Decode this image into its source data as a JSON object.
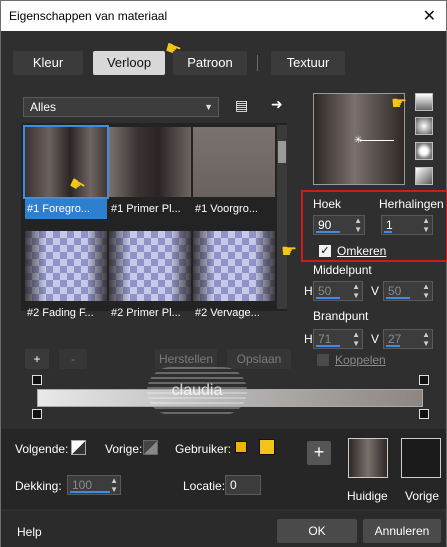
{
  "window": {
    "title": "Eigenschappen van materiaal",
    "close_icon": "close-icon"
  },
  "tabs": [
    {
      "label": "Kleur",
      "active": false
    },
    {
      "label": "Verloop",
      "active": true
    },
    {
      "label": "Patroon",
      "active": false
    },
    {
      "label": "Textuur",
      "active": false
    }
  ],
  "category": {
    "value": "Alles"
  },
  "swatches": [
    {
      "label": "#1 Foregro...",
      "selected": true
    },
    {
      "label": "#1 Primer Pl...",
      "selected": false
    },
    {
      "label": "#1 Voorgro...",
      "selected": false
    },
    {
      "label": "#2 Fading F...",
      "selected": false
    },
    {
      "label": "#2 Primer Pl...",
      "selected": false
    },
    {
      "label": "#2 Vervage...",
      "selected": false
    }
  ],
  "list_buttons": {
    "add": "+",
    "remove": "-",
    "reset": "Herstellen",
    "save": "Opslaan"
  },
  "angle": {
    "label": "Hoek",
    "value": "90"
  },
  "repeats": {
    "label": "Herhalingen",
    "value": "1"
  },
  "invert": {
    "label": "Omkeren",
    "checked": true
  },
  "center": {
    "label": "Middelpunt",
    "h": "50",
    "v": "50",
    "h_label": "H",
    "v_label": "V"
  },
  "focal": {
    "label": "Brandpunt",
    "h": "71",
    "v": "27",
    "h_label": "H",
    "v_label": "V"
  },
  "link": {
    "label": "Koppelen",
    "checked": false
  },
  "watermark": "claudia",
  "bottom": {
    "next_label": "Volgende:",
    "prev_label": "Vorige:",
    "user_label": "Gebruiker:",
    "opacity_label": "Dekking:",
    "opacity_value": "100",
    "location_label": "Locatie:",
    "location_value": "0",
    "user_color_1": "#f0b400",
    "user_color_2": "#f0c419"
  },
  "current": {
    "label": "Huidige"
  },
  "previous": {
    "label": "Vorige"
  },
  "footer": {
    "help": "Help",
    "ok": "OK",
    "cancel": "Annuleren"
  }
}
